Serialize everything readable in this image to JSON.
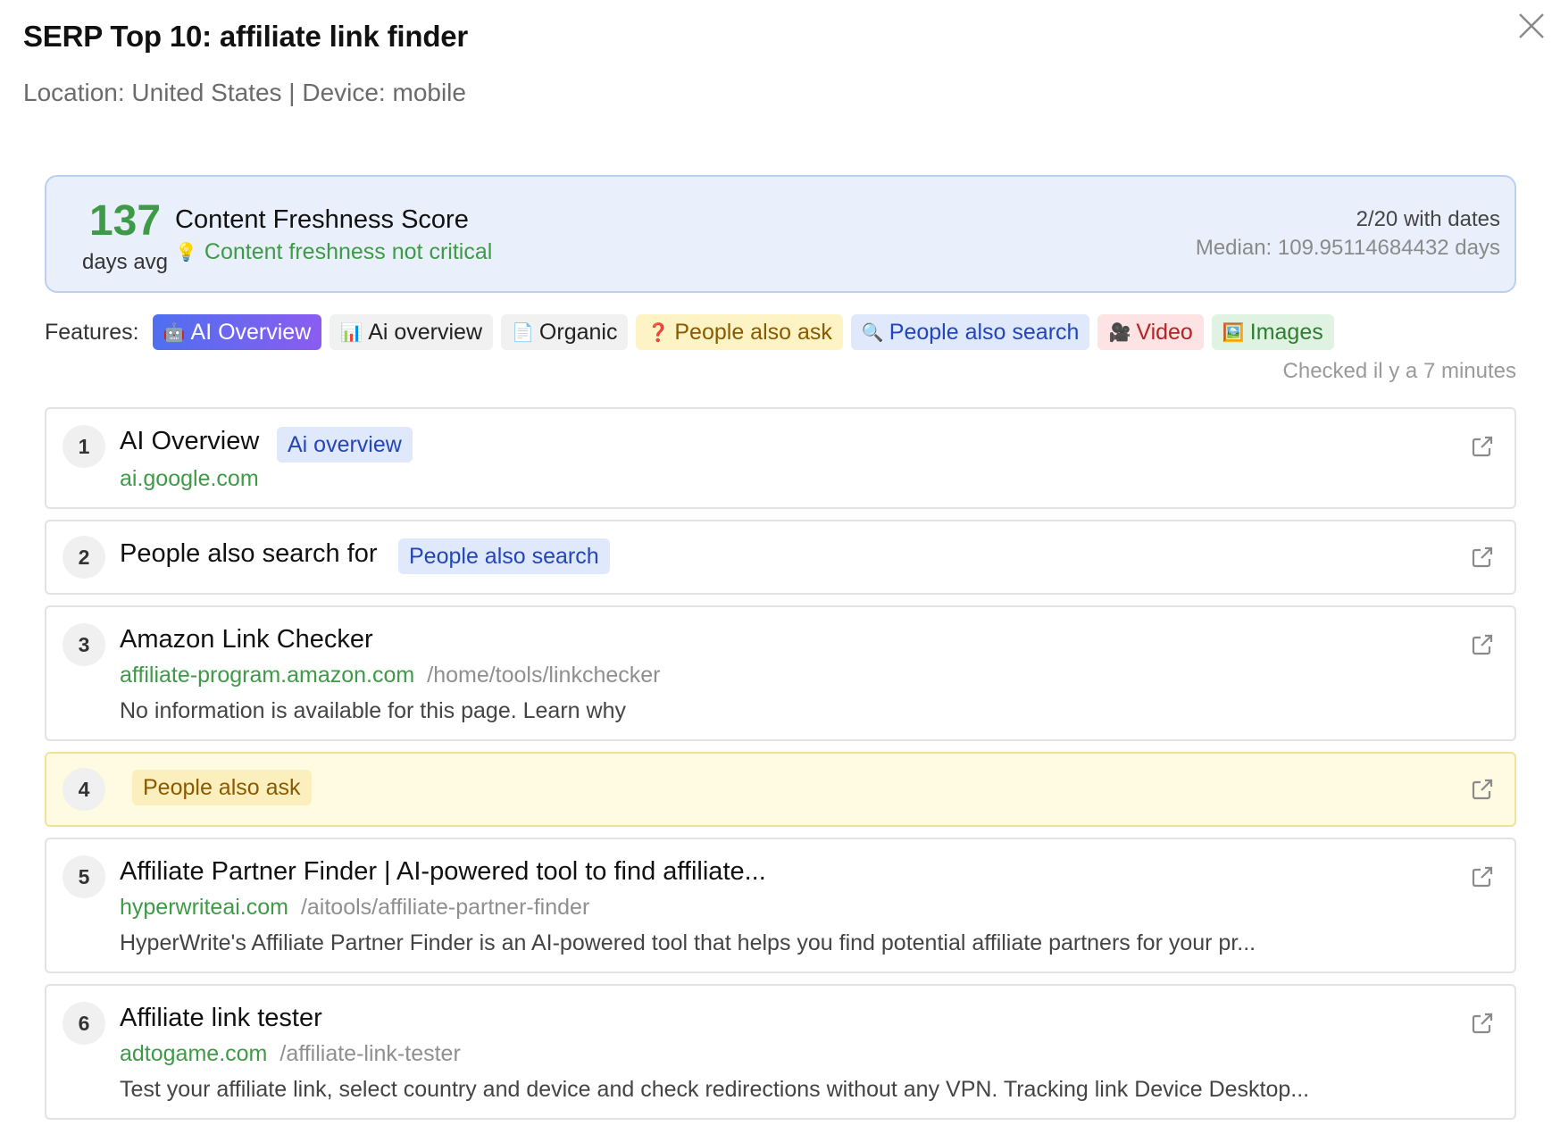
{
  "header": {
    "title": "SERP Top 10: affiliate link finder",
    "subtitle": "Location: United States | Device: mobile"
  },
  "freshness": {
    "score": "137",
    "unit": "days avg",
    "title": "Content Freshness Score",
    "status": "Content freshness not critical",
    "dates_count": "2/20 with dates",
    "median": "Median: 109.95114684432 days"
  },
  "features": {
    "label": "Features:",
    "chips": [
      {
        "icon": "🤖",
        "label": "AI Overview"
      },
      {
        "icon": "📊",
        "label": "Ai overview"
      },
      {
        "icon": "📄",
        "label": "Organic"
      },
      {
        "icon": "❓",
        "label": "People also ask"
      },
      {
        "icon": "🔍",
        "label": "People also search"
      },
      {
        "icon": "🎥",
        "label": "Video"
      },
      {
        "icon": "🖼️",
        "label": "Images"
      }
    ],
    "checked": "Checked il y a 7 minutes"
  },
  "colors": {
    "accent_green": "#3f9a47",
    "freshness_bg": "#e9f0fb",
    "paa_bg": "#fefbe2"
  },
  "results": [
    {
      "rank": "1",
      "title": "AI Overview",
      "tag": "Ai overview",
      "domain": "ai.google.com",
      "path": "",
      "snippet": ""
    },
    {
      "rank": "2",
      "title": "People also search for",
      "tag": "People also search",
      "domain": "",
      "path": "",
      "snippet": ""
    },
    {
      "rank": "3",
      "title": "Amazon Link Checker",
      "tag": "",
      "domain": "affiliate-program.amazon.com",
      "path": "/home/tools/linkchecker",
      "snippet": "No information is available for this page. Learn why"
    },
    {
      "rank": "4",
      "title": "",
      "tag": "People also ask",
      "domain": "",
      "path": "",
      "snippet": ""
    },
    {
      "rank": "5",
      "title": "Affiliate Partner Finder | AI-powered tool to find affiliate...",
      "tag": "",
      "domain": "hyperwriteai.com",
      "path": "/aitools/affiliate-partner-finder",
      "snippet": "HyperWrite's Affiliate Partner Finder is an AI-powered tool that helps you find potential affiliate partners for your pr..."
    },
    {
      "rank": "6",
      "title": "Affiliate link tester",
      "tag": "",
      "domain": "adtogame.com",
      "path": "/affiliate-link-tester",
      "snippet": "Test your affiliate link, select country and device and check redirections without any VPN. Tracking link Device Desktop..."
    }
  ]
}
